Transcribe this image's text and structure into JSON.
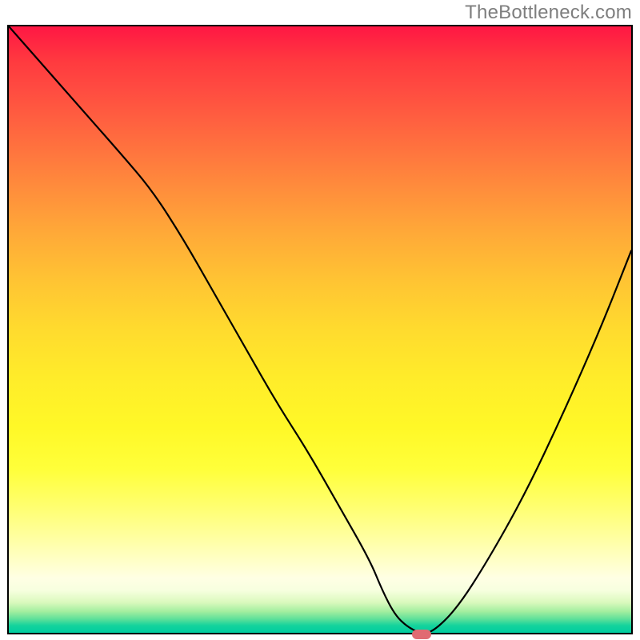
{
  "watermark": "TheBottleneck.com",
  "chart_data": {
    "type": "line",
    "title": "",
    "xlabel": "",
    "ylabel": "",
    "xlim": [
      0,
      100
    ],
    "ylim": [
      0,
      100
    ],
    "background_gradient": {
      "top_color": "#ff1744",
      "bottom_color": "#00cda0",
      "meaning": "high (red) to low (green) bottleneck level"
    },
    "series": [
      {
        "name": "bottleneck-curve",
        "color": "#000000",
        "x": [
          0,
          6,
          12,
          18,
          23,
          28,
          33,
          38,
          43,
          48,
          53,
          58,
          60,
          62,
          64,
          66,
          68,
          72,
          77,
          83,
          89,
          95,
          100
        ],
        "y": [
          100,
          93,
          86,
          79,
          73,
          65,
          56,
          47,
          38,
          30,
          21,
          12,
          7,
          3,
          1,
          0,
          0,
          4,
          12,
          23,
          36,
          50,
          63
        ]
      }
    ],
    "marker": {
      "name": "optimal-point",
      "x": 66,
      "y": 0,
      "color": "#e06a72"
    },
    "grid": false,
    "legend": false
  }
}
